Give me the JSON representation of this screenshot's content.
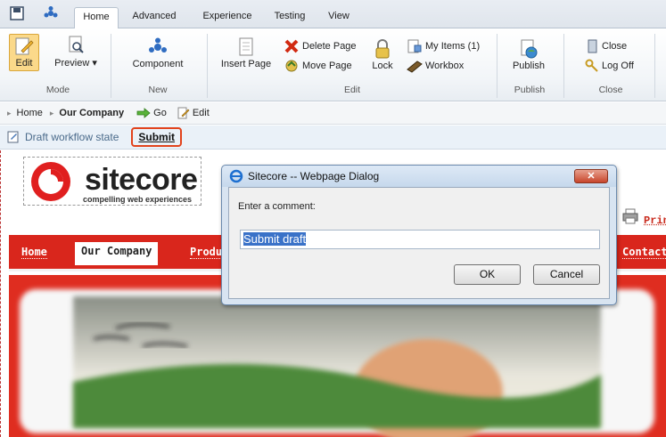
{
  "ribbon_tabs": [
    "Home",
    "Advanced",
    "Experience",
    "Testing",
    "View"
  ],
  "active_tab": "Home",
  "groups": {
    "mode": {
      "title": "Mode",
      "edit": "Edit",
      "preview": "Preview"
    },
    "new": {
      "title": "New",
      "component": "Component"
    },
    "edit": {
      "title": "Edit",
      "insert_page": "Insert Page",
      "delete_page": "Delete Page",
      "move_page": "Move Page",
      "lock": "Lock",
      "my_items": "My Items (1)",
      "workbox": "Workbox"
    },
    "publish": {
      "title": "Publish",
      "publish": "Publish"
    },
    "close": {
      "title": "Close",
      "close": "Close",
      "log_off": "Log Off"
    }
  },
  "breadcrumb": {
    "home": "Home",
    "current": "Our Company",
    "go": "Go",
    "edit": "Edit"
  },
  "workflow": {
    "state": "Draft workflow state",
    "submit": "Submit"
  },
  "site": {
    "logo_word": "sitecore",
    "logo_tagline": "compelling web experiences",
    "print": "Prin",
    "nav": [
      "Home",
      "Our Company",
      "Produ",
      "Contact"
    ]
  },
  "dialog": {
    "title": "Sitecore -- Webpage Dialog",
    "label": "Enter a comment:",
    "value": "Submit draft",
    "ok": "OK",
    "cancel": "Cancel",
    "close_glyph": "✕"
  },
  "colors": {
    "brand_red": "#d9261c",
    "highlight": "#e2431c",
    "selection": "#3a72c8"
  }
}
